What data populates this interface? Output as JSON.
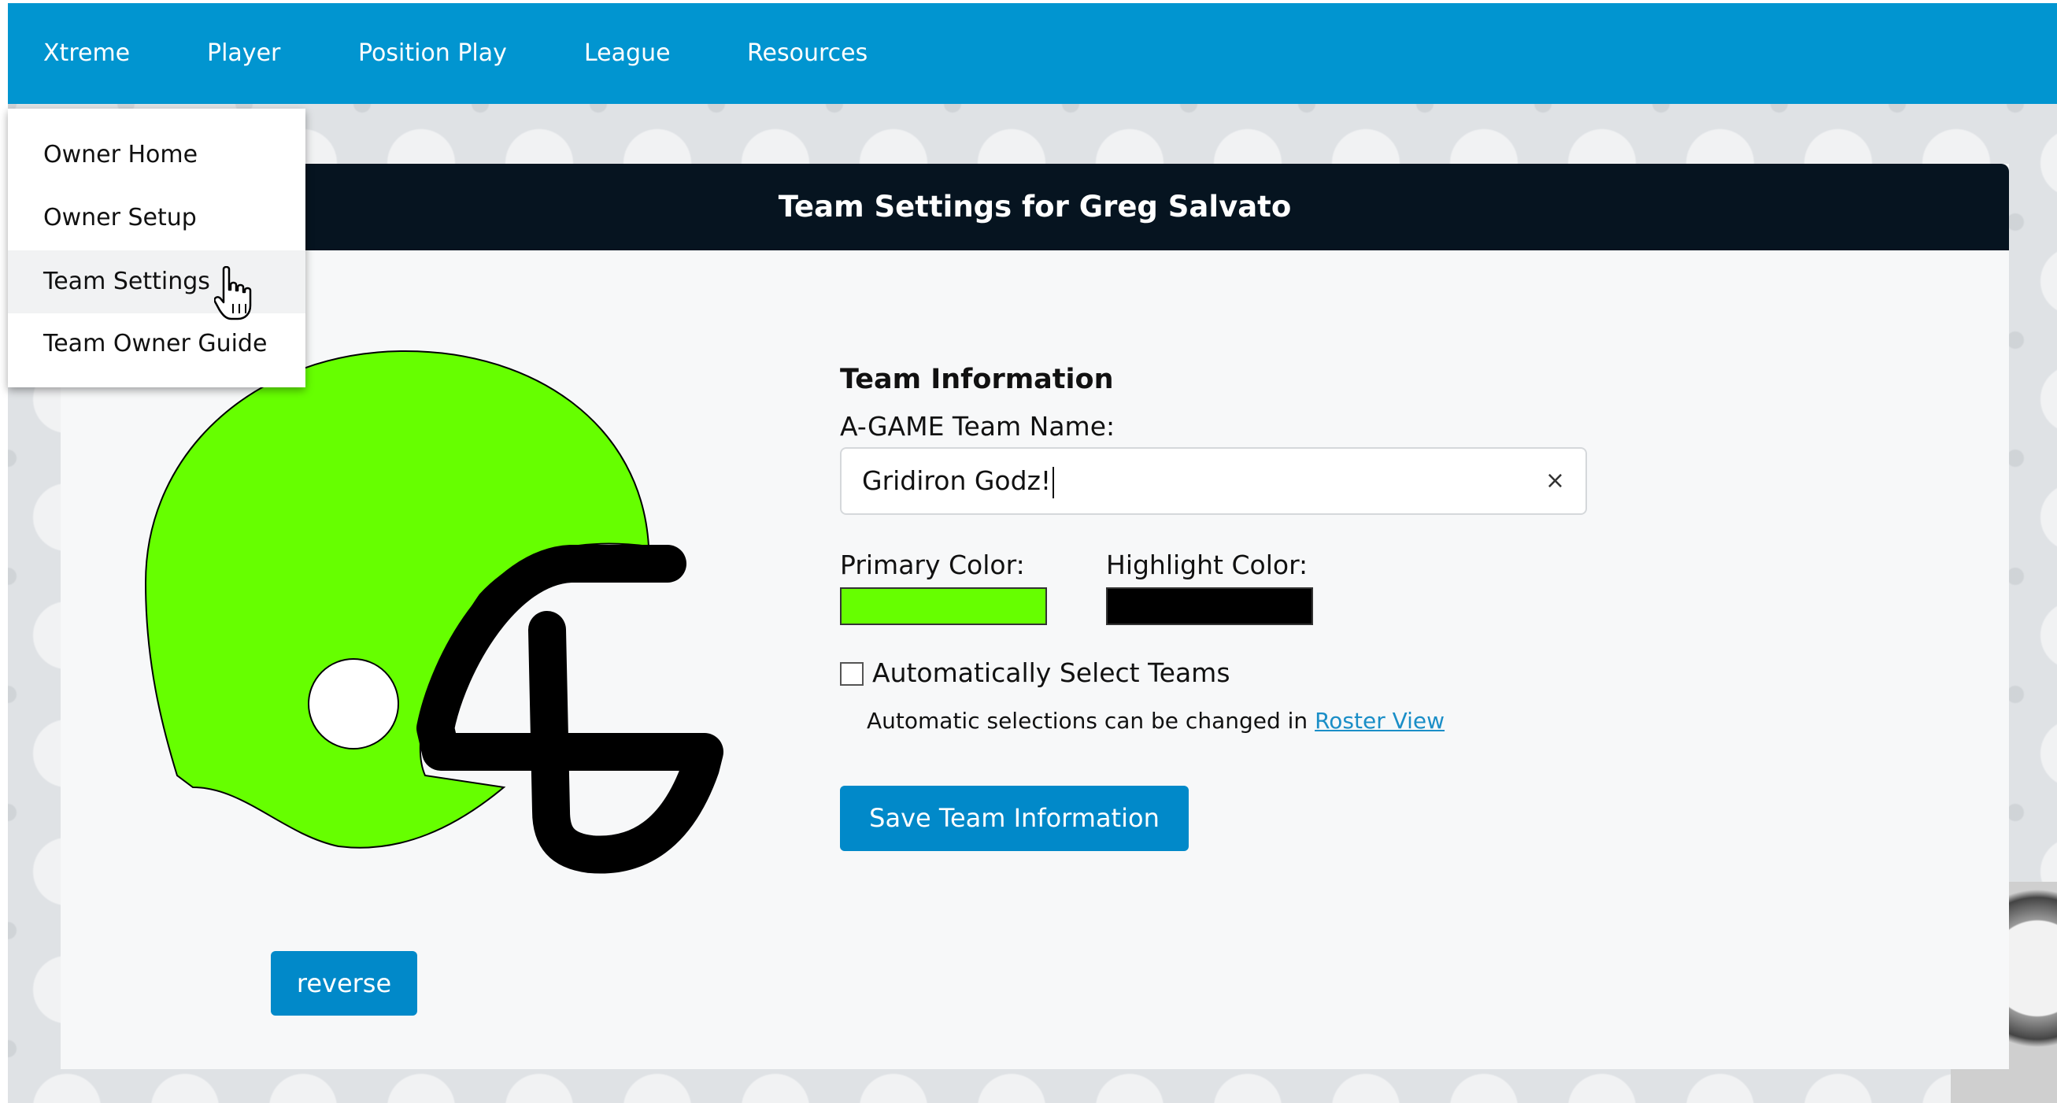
{
  "nav": {
    "items": [
      "Xtreme",
      "Player",
      "Position Play",
      "League",
      "Resources"
    ]
  },
  "dropdown": {
    "items": [
      "Owner Home",
      "Owner Setup",
      "Team Settings",
      "Team Owner Guide"
    ],
    "active": "Team Settings"
  },
  "panel": {
    "title": "Team Settings for Greg Salvato"
  },
  "helmet": {
    "primary_color": "#66ff00",
    "facemask_color": "#000000"
  },
  "reverse_label": "reverse",
  "team_info": {
    "heading": "Team Information",
    "name_label": "A-GAME Team Name:",
    "name_value": "Gridiron Godz!",
    "clear_symbol": "×",
    "primary_color_label": "Primary Color:",
    "primary_color": "#66ff00",
    "highlight_color_label": "Highlight Color:",
    "highlight_color": "#000000",
    "auto_select_label": "Automatically Select Teams",
    "auto_select_checked": false,
    "note_text": "Automatic selections can be changed in ",
    "note_link": "Roster View",
    "save_label": "Save Team Information"
  },
  "icons": {
    "cursor": "pointer-hand-icon",
    "clear": "close-icon"
  }
}
